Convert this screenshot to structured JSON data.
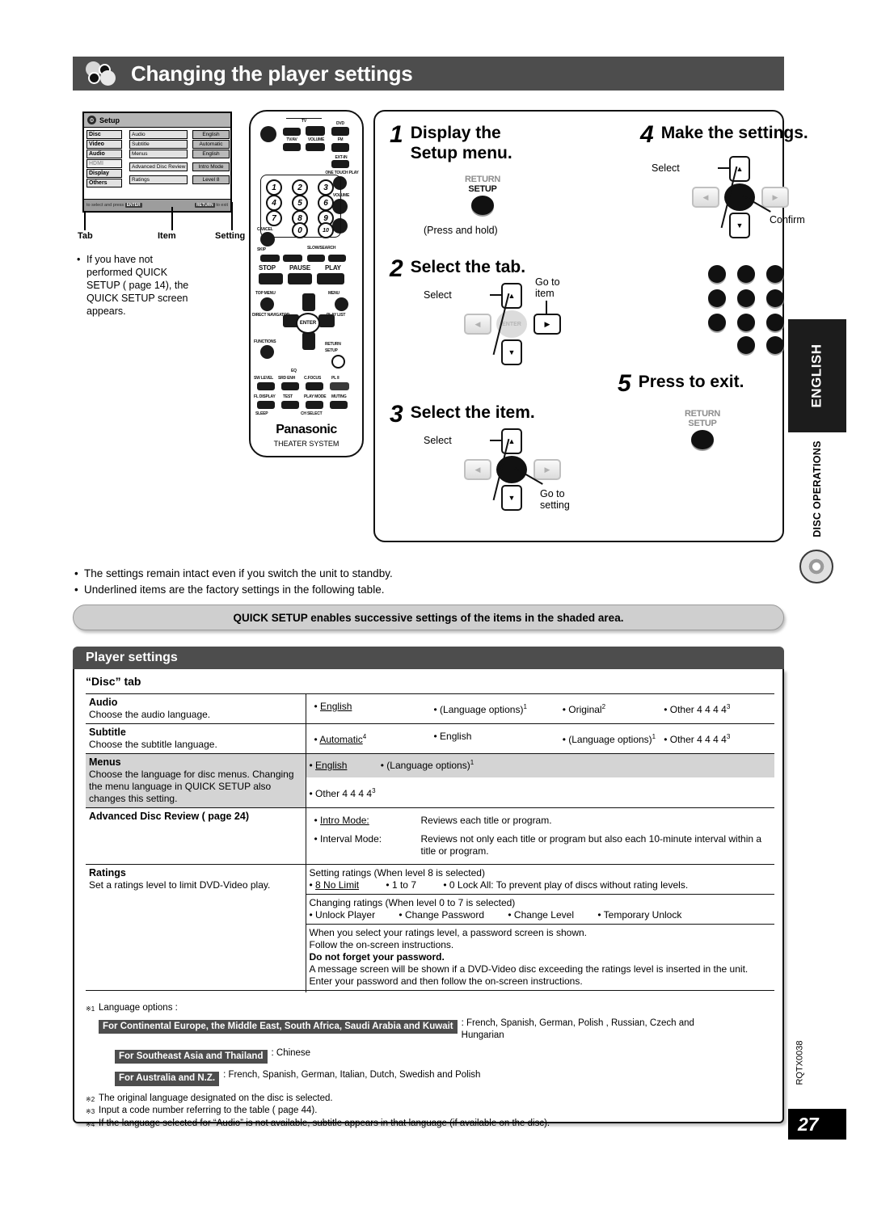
{
  "header": {
    "title": "Changing the player settings"
  },
  "osd": {
    "title": "Setup",
    "tabs": [
      "Disc",
      "Video",
      "Audio",
      "HDMI",
      "Display",
      "Others"
    ],
    "items": [
      "Audio",
      "Subtitle",
      "Menus",
      "Advanced Disc Review",
      "Ratings"
    ],
    "settings": [
      "English",
      "Automatic",
      "English",
      "Intro Mode",
      "Level 8 "
    ],
    "footer_left": "to select and press",
    "footer_left_key": "ENTER",
    "footer_right": "to exit",
    "footer_right_key": "RETURN"
  },
  "callouts": {
    "tab": "Tab",
    "item": "Item",
    "setting": "Setting"
  },
  "note": "If you have not performed QUICK SETUP (  page 14), the QUICK SETUP screen appears.",
  "remote": {
    "brand": "Panasonic",
    "system": "THEATER SYSTEM",
    "labels": {
      "tv": "TV",
      "tv_av": "TV/AV",
      "volume": "VOLUME",
      "dvd": "DVD",
      "fm": "FM",
      "ext_in": "EXT-IN",
      "one_touch_play": "ONE TOUCH PLAY",
      "volume2": "VOLUME",
      "cancel": "CANCEL",
      "skip": "SKIP",
      "slow_search": "SLOW/SEARCH",
      "stop": "STOP",
      "pause": "PAUSE",
      "play": "PLAY",
      "top_menu": "TOP MENU",
      "direct_navigator": "DIRECT NAVIGATOR",
      "menu": "MENU",
      "play_list": "PLAY LIST",
      "functions": "FUNCTIONS",
      "enter": "ENTER",
      "return": "RETURN",
      "setup": "SETUP",
      "eq": "EQ",
      "sw_level": "SW LEVEL",
      "srd_enh": "SRD ENH",
      "c_focus": "C.FOCUS",
      "pl2": "PL II",
      "fl_display": "FL DISPLAY",
      "test": "TEST",
      "play_mode": "PLAY MODE",
      "muting": "MUTING",
      "sleep": "SLEEP",
      "ch_select": "CH SELECT"
    },
    "numbers": [
      "1",
      "2",
      "3",
      "4",
      "5",
      "6",
      "7",
      "8",
      "9",
      "0",
      "10"
    ]
  },
  "steps": [
    {
      "num": "1",
      "title": "Display the Setup menu.",
      "hint": "(Press and hold)",
      "button_return": "RETURN",
      "button_setup": "SETUP"
    },
    {
      "num": "2",
      "title": "Select the tab.",
      "select": "Select",
      "goto": "Go to item"
    },
    {
      "num": "3",
      "title": "Select the item.",
      "select": "Select",
      "goto": "Go to setting"
    },
    {
      "num": "4",
      "title": "Make the settings.",
      "select": "Select",
      "confirm": "Confirm"
    },
    {
      "num": "5",
      "title": "Press to exit.",
      "button_return": "RETURN",
      "button_setup": "SETUP"
    }
  ],
  "bullets": [
    "The settings remain intact even if you switch the unit to standby.",
    "Underlined items are the factory settings in the following table."
  ],
  "quick_setup_banner": "QUICK SETUP enables successive settings of the items in the shaded area.",
  "player_settings": {
    "title": "Player settings",
    "disc_tab": "“Disc” tab"
  },
  "table": {
    "audio": {
      "name": "Audio",
      "desc": "Choose the audio language.",
      "options": [
        {
          "label": "English",
          "default": true
        },
        {
          "label": "(Language options)",
          "sup": "1"
        },
        {
          "label": "Original",
          "sup": "2"
        },
        {
          "label": "Other  4  4  4  4",
          "sup": "3"
        }
      ]
    },
    "subtitle": {
      "name": "Subtitle",
      "desc": "Choose the subtitle language.",
      "options": [
        {
          "label": "Automatic",
          "sup": "4",
          "default": true
        },
        {
          "label": "English"
        },
        {
          "label": "(Language options)",
          "sup": "1"
        },
        {
          "label": "Other  4  4  4  4",
          "sup": "3"
        }
      ]
    },
    "menus": {
      "name": "Menus",
      "desc": "Choose the language for disc menus. Changing the menu language in QUICK SETUP also changes this setting.",
      "options_shaded": [
        {
          "label": "English",
          "default": true
        },
        {
          "label": "(Language options)",
          "sup": "1"
        }
      ],
      "options_plain": [
        {
          "label": "Other  4  4  4  4",
          "sup": "3"
        }
      ]
    },
    "advanced": {
      "name": "Advanced Disc Review (    page 24)",
      "rows": [
        {
          "label": "Intro Mode:",
          "default": true,
          "text": "Reviews each title or program."
        },
        {
          "label": "Interval Mode:",
          "text": "Reviews not only each title or program but also each 10-minute interval within a title or program."
        }
      ]
    },
    "ratings": {
      "name": "Ratings",
      "desc": "Set a ratings level to limit DVD-Video play.",
      "block1_head": "Setting ratings (When level 8 is selected)",
      "block1_options": [
        {
          "label": "8 No Limit",
          "default": true
        },
        {
          "label": "1 to 7"
        },
        {
          "label": "0 Lock All: To prevent play of discs without rating levels."
        }
      ],
      "block2_head": "Changing ratings (When level 0 to 7 is selected)",
      "block2_options": [
        {
          "label": "Unlock Player"
        },
        {
          "label": "Change Password"
        },
        {
          "label": "Change Level"
        },
        {
          "label": "Temporary Unlock"
        }
      ],
      "block3_lines": [
        "When you select your ratings level, a password screen is shown.",
        "Follow the on-screen instructions."
      ],
      "block3_bold": "Do not forget your password.",
      "block3_lines2": [
        "A message screen will be shown if a DVD-Video disc exceeding the ratings level is inserted in the unit.",
        "Enter your password and then follow the on-screen instructions."
      ]
    }
  },
  "footnotes": {
    "fn1_title": "Language options :",
    "regions": [
      {
        "box": "For Continental Europe, the Middle East, South Africa, Saudi Arabia and Kuwait",
        "text": ": French, Spanish, German, Polish , Russian, Czech and Hungarian"
      },
      {
        "box": "For Southeast Asia and Thailand",
        "text": ": Chinese"
      },
      {
        "box": "For Australia and N.Z.",
        "text": ": French, Spanish, German, Italian, Dutch, Swedish and Polish"
      }
    ],
    "fn2": "The original language designated on the disc is selected.",
    "fn3": "Input a code number referring to the table (    page 44).",
    "fn4": "If the language selected for “Audio” is not available, subtitle appears in that language (if available on the disc)."
  },
  "sidebar": {
    "language_tab": "ENGLISH",
    "section": "DISC OPERATIONS"
  },
  "footer": {
    "doc_code": "RQTX0038",
    "page_number": "27"
  }
}
